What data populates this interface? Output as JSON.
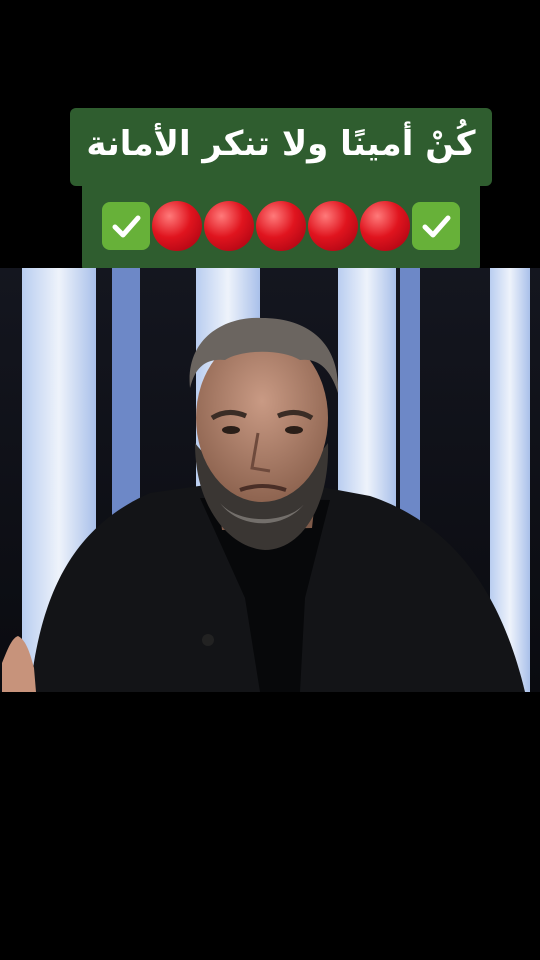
{
  "caption": {
    "text": "كُنْ أمينًا ولا تنكر الأمانة",
    "emoji_row": [
      "check-mark-icon",
      "red-circle-icon",
      "red-circle-icon",
      "red-circle-icon",
      "red-circle-icon",
      "red-circle-icon",
      "check-mark-icon"
    ]
  },
  "colors": {
    "caption_bg": "#2f5d2f",
    "check_bg": "#67b139",
    "dot_red": "#e0141e",
    "studio_blue": "#c7d9f5"
  }
}
